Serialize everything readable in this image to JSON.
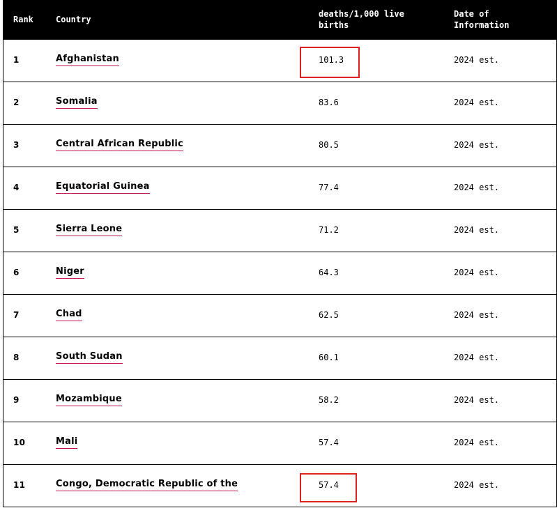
{
  "table": {
    "headers": {
      "rank": "Rank",
      "country": "Country",
      "value": "deaths/1,000 live births",
      "date": "Date of Information"
    },
    "rows": [
      {
        "rank": "1",
        "country": "Afghanistan",
        "value": "101.3",
        "date": "2024 est."
      },
      {
        "rank": "2",
        "country": "Somalia",
        "value": "83.6",
        "date": "2024 est."
      },
      {
        "rank": "3",
        "country": "Central African Republic",
        "value": "80.5",
        "date": "2024 est."
      },
      {
        "rank": "4",
        "country": "Equatorial Guinea",
        "value": "77.4",
        "date": "2024 est."
      },
      {
        "rank": "5",
        "country": "Sierra Leone",
        "value": "71.2",
        "date": "2024 est."
      },
      {
        "rank": "6",
        "country": "Niger",
        "value": "64.3",
        "date": "2024 est."
      },
      {
        "rank": "7",
        "country": "Chad",
        "value": "62.5",
        "date": "2024 est."
      },
      {
        "rank": "8",
        "country": "South Sudan",
        "value": "60.1",
        "date": "2024 est."
      },
      {
        "rank": "9",
        "country": "Mozambique",
        "value": "58.2",
        "date": "2024 est."
      },
      {
        "rank": "10",
        "country": "Mali",
        "value": "57.4",
        "date": "2024 est."
      },
      {
        "rank": "11",
        "country": "Congo, Democratic Republic of the",
        "value": "57.4",
        "date": "2024 est."
      }
    ]
  },
  "colors": {
    "header_bg": "#000000",
    "header_text": "#ffffff",
    "link_underline": "#c4124a",
    "highlight": "#e02020"
  }
}
